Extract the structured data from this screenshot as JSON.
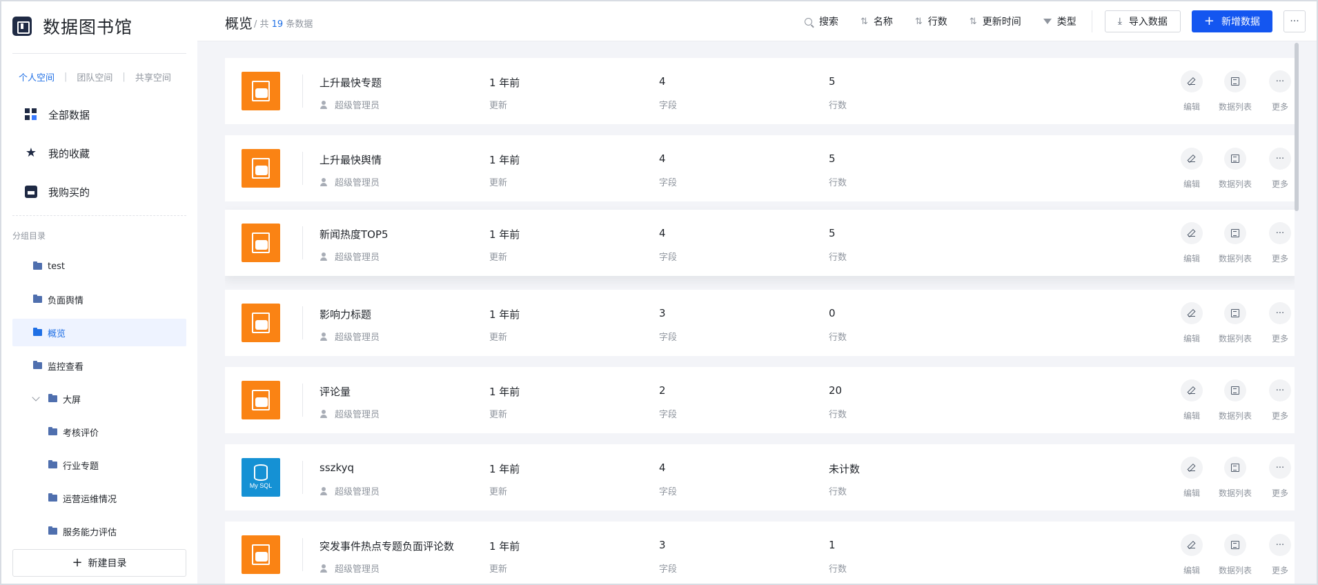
{
  "brand": {
    "title": "数据图书馆"
  },
  "space_tabs": [
    {
      "label": "个人空间",
      "active": true
    },
    {
      "label": "团队空间",
      "active": false
    },
    {
      "label": "共享空间",
      "active": false
    }
  ],
  "main_nav": [
    {
      "label": "全部数据",
      "icon": "grid-icon"
    },
    {
      "label": "我的收藏",
      "icon": "star-icon"
    },
    {
      "label": "我购买的",
      "icon": "shop-icon"
    }
  ],
  "group": {
    "label": "分组目录",
    "items": [
      {
        "label": "test",
        "level": 1
      },
      {
        "label": "负面舆情",
        "level": 1
      },
      {
        "label": "概览",
        "level": 1,
        "active": true
      },
      {
        "label": "监控查看",
        "level": 1
      },
      {
        "label": "大屏",
        "level": 1,
        "expanded": true
      },
      {
        "label": "考核评价",
        "level": 2
      },
      {
        "label": "行业专题",
        "level": 2
      },
      {
        "label": "运营运维情况",
        "level": 2
      },
      {
        "label": "服务能力评估",
        "level": 2
      }
    ],
    "new_button": "新建目录"
  },
  "header": {
    "title": "概览",
    "sub_prefix": "/ 共",
    "count": "19",
    "sub_suffix": "条数据",
    "tools": {
      "search": "搜索",
      "name": "名称",
      "rows": "行数",
      "updated": "更新时间",
      "type": "类型"
    },
    "import_label": "导入数据",
    "add_label": "新增数据",
    "more_label": "···"
  },
  "labels": {
    "updated": "更新",
    "fields": "字段",
    "rows": "行数",
    "edit": "编辑",
    "data_list": "数据列表",
    "more": "更多"
  },
  "datasets": [
    {
      "name": "上升最快专题",
      "owner": "超级管理员",
      "updated": "1 年前",
      "fields": "4",
      "rows": "5",
      "icon": "excel"
    },
    {
      "name": "上升最快舆情",
      "owner": "超级管理员",
      "updated": "1 年前",
      "fields": "4",
      "rows": "5",
      "icon": "excel"
    },
    {
      "name": "新闻热度TOP5",
      "owner": "超级管理员",
      "updated": "1 年前",
      "fields": "4",
      "rows": "5",
      "icon": "excel"
    },
    {
      "name": "影响力标题",
      "owner": "超级管理员",
      "updated": "1 年前",
      "fields": "3",
      "rows": "0",
      "icon": "excel"
    },
    {
      "name": "评论量",
      "owner": "超级管理员",
      "updated": "1 年前",
      "fields": "2",
      "rows": "20",
      "icon": "excel"
    },
    {
      "name": "sszkyq",
      "owner": "超级管理员",
      "updated": "1 年前",
      "fields": "4",
      "rows": "未计数",
      "icon": "mysql",
      "icon_text": "My SQL"
    },
    {
      "name": "突发事件热点专题负面评论数",
      "owner": "超级管理员",
      "updated": "1 年前",
      "fields": "3",
      "rows": "1",
      "icon": "excel"
    }
  ],
  "colors": {
    "accent": "#1456f0",
    "excel": "#fa8314",
    "mysql": "#1591d4"
  }
}
